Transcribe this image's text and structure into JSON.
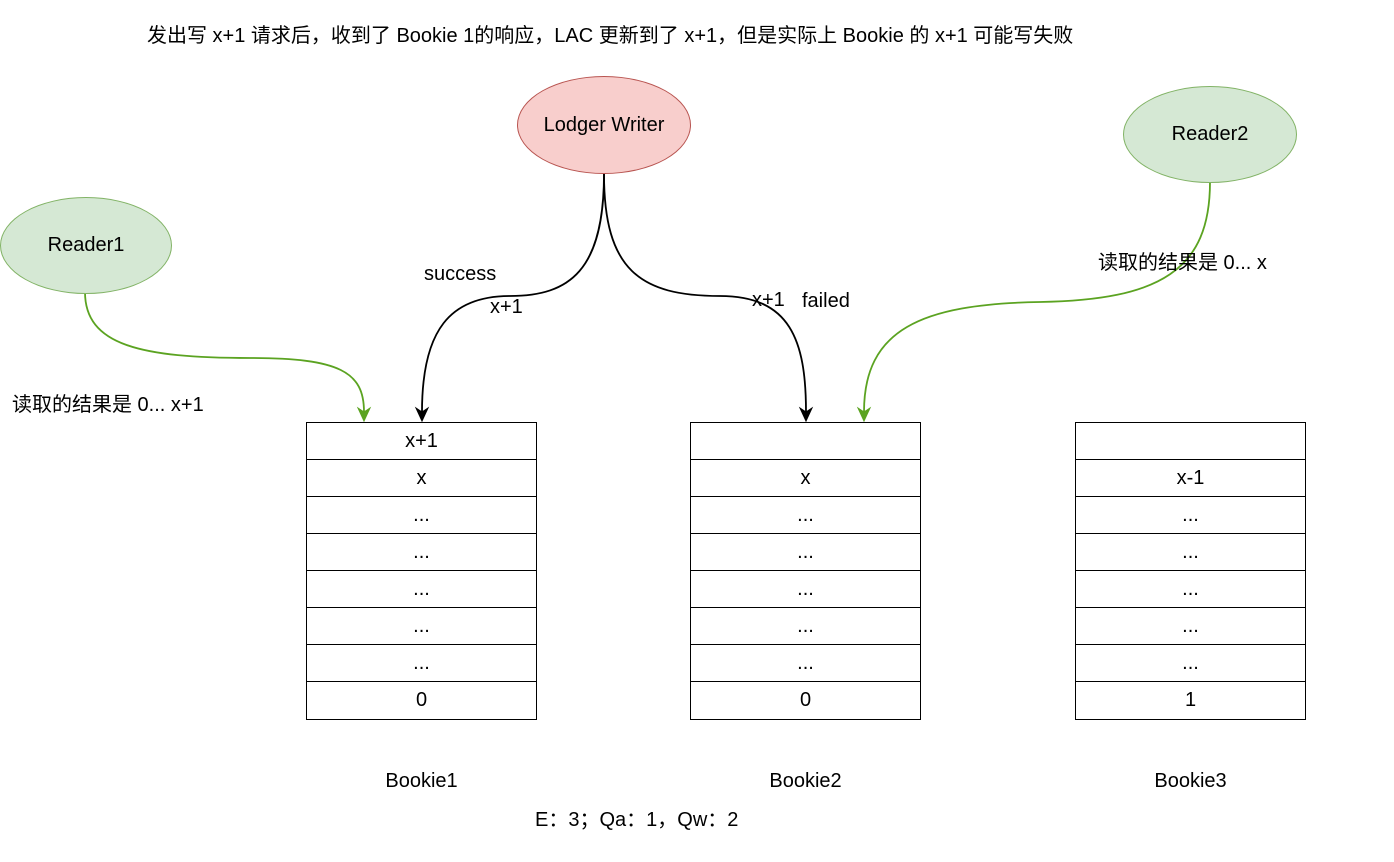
{
  "title": "发出写 x+1 请求后，收到了 Bookie 1的响应，LAC 更新到了 x+1，但是实际上 Bookie 的 x+1 可能写失败",
  "nodes": {
    "writer": "Lodger Writer",
    "reader1": "Reader1",
    "reader2": "Reader2"
  },
  "edge_labels": {
    "success": "success",
    "success_entry": "x+1",
    "failed_entry": "x+1",
    "failed": "failed",
    "reader1_result": "读取的结果是 0... x+1",
    "reader2_result": "读取的结果是 0... x"
  },
  "bookies": [
    {
      "label": "Bookie1",
      "cells": [
        "x+1",
        "x",
        "...",
        "...",
        "...",
        "...",
        "...",
        "0"
      ]
    },
    {
      "label": "Bookie2",
      "cells": [
        "",
        "x",
        "...",
        "...",
        "...",
        "...",
        "...",
        "0"
      ]
    },
    {
      "label": "Bookie3",
      "cells": [
        "",
        "x-1",
        "...",
        "...",
        "...",
        "...",
        "...",
        "1"
      ]
    }
  ],
  "footer": "E：3；Qa：1，Qw：2",
  "colors": {
    "writer_fill": "#f8cecc",
    "writer_stroke": "#b85450",
    "reader_fill": "#d5e8d4",
    "reader_stroke": "#82b366",
    "reader_edge": "#5ba321",
    "writer_edge": "#000000"
  }
}
